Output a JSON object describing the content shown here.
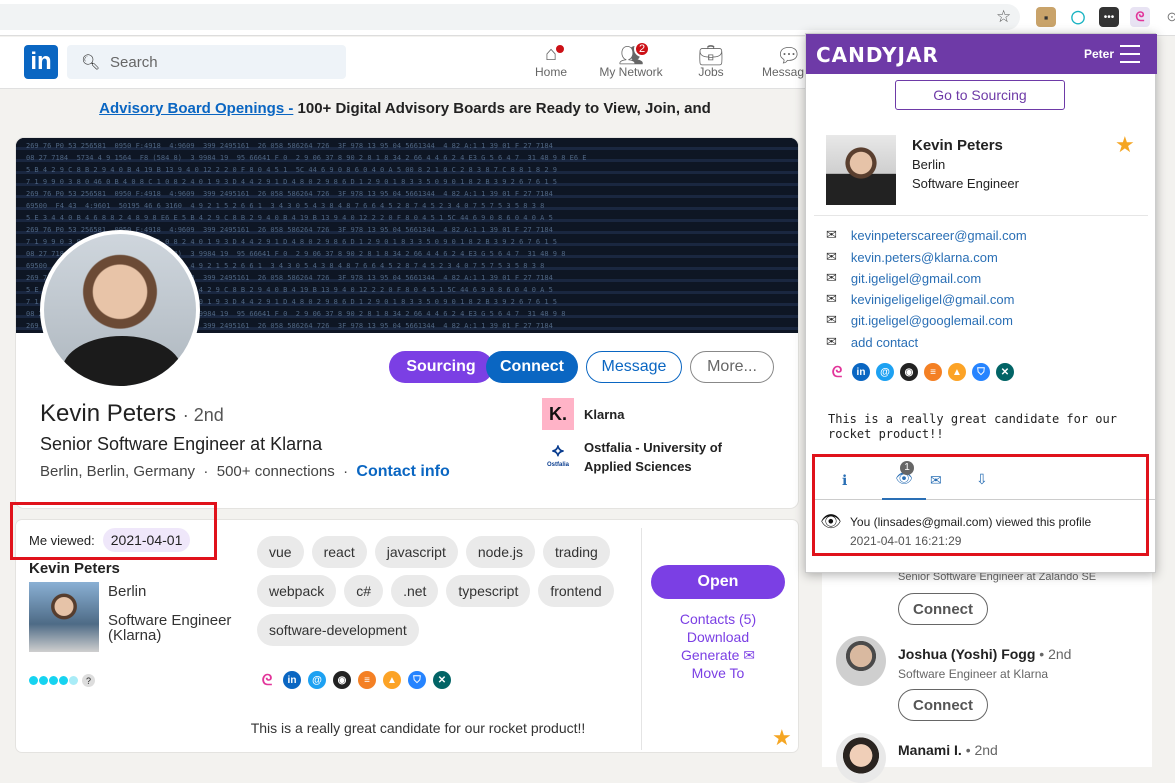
{
  "nav": {
    "search_placeholder": "Search",
    "items": [
      {
        "label": "Home",
        "badge": ""
      },
      {
        "label": "My Network",
        "badge": "2"
      },
      {
        "label": "Jobs",
        "badge": ""
      },
      {
        "label": "Messag",
        "badge": ""
      }
    ]
  },
  "banner": {
    "link": "Advisory Board Openings -",
    "text": " 100+ Digital Advisory Boards are Ready to View, Join, and"
  },
  "profile": {
    "actions": {
      "sourcing": "Sourcing",
      "connect": "Connect",
      "message": "Message",
      "more": "More..."
    },
    "name": "Kevin Peters",
    "degree": "· 2nd",
    "headline": "Senior Software Engineer at Klarna",
    "location": "Berlin, Berlin, Germany",
    "connections": "500+ connections",
    "contact_info": "Contact info",
    "orgs": [
      {
        "logo": "K.",
        "name": "Klarna"
      },
      {
        "logo": "Ostfalia",
        "name": "Ostfalia - University of Applied Sciences"
      }
    ]
  },
  "cj_inline": {
    "viewed_label": "Me viewed:",
    "viewed_date": "2021-04-01",
    "name": "Kevin Peters",
    "city": "Berlin",
    "title": "Software Engineer (Klarna)",
    "score_hint": "?",
    "tags": [
      "vue",
      "react",
      "javascript",
      "node.js",
      "trading",
      "webpack",
      "c#",
      ".net",
      "typescript",
      "frontend",
      "software-development"
    ],
    "note": "This is a really great candidate for our rocket product!!",
    "open": "Open",
    "links": [
      "Contacts (5)",
      "Download",
      "Generate",
      "Move To"
    ]
  },
  "right": {
    "people": [
      {
        "name": "",
        "title": "Senior Software Engineer at Zalando SE",
        "button": "Connect"
      },
      {
        "name": "Joshua (Yoshi) Fogg",
        "degree": "• 2nd",
        "title": "Software Engineer at Klarna",
        "button": "Connect"
      },
      {
        "name": "Manami I.",
        "degree": "• 2nd",
        "title": ""
      }
    ]
  },
  "popup": {
    "brand": "CANDYJAR",
    "user": "Peter",
    "goto": "Go to Sourcing",
    "name": "Kevin Peters",
    "city": "Berlin",
    "title": "Software Engineer",
    "emails": [
      "kevinpeterscareer@gmail.com",
      "kevin.peters@klarna.com",
      "git.igeligel@gmail.com",
      "kevinigeligeligel@gmail.com",
      "git.igeligel@googlemail.com"
    ],
    "add_contact": "add contact",
    "note": "This is a really great candidate for our rocket product!!",
    "tab_badge": "1",
    "activity": "You (linsades@gmail.com) viewed this profile",
    "activity_time": "2021-04-01 16:21:29"
  },
  "colors": {
    "accent": "#6e3aa7",
    "linkedin": "#0a66c2",
    "highlight": "#e0121b",
    "star": "#f5a623"
  }
}
